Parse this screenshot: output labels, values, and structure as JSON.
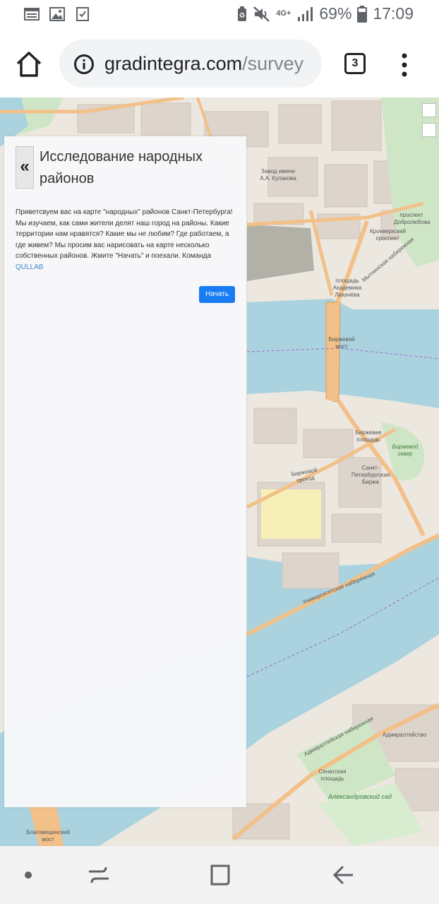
{
  "status_bar": {
    "network_type": "4G+",
    "battery_percent": "69%",
    "time": "17:09",
    "icons": [
      "calendar-icon",
      "gallery-icon",
      "checklist-icon",
      "battery-saver-icon",
      "mute-icon",
      "signal-icon",
      "battery-icon"
    ]
  },
  "browser": {
    "url_domain": "gradintegra.com",
    "url_path": "/survey",
    "tab_count": "3",
    "icons": [
      "home-icon",
      "info-icon",
      "menu-dots-icon"
    ]
  },
  "survey_panel": {
    "collapse_label": "«",
    "title": "Исследование народных районов",
    "intro_text": "Приветсвуем вас на карте \"народных\" районов Санкт-Петербурга! Мы изучаем, как сами жители делят наш город на районы. Какие территории нам нравятся? Какие мы не любим? Где работаем, а где живем? Мы просим вас нарисовать на карте несколько собственных районов. Жмите \"Начать\" и поехали. Команда",
    "team_link": "QULLAB",
    "start_button": "Начать"
  },
  "map": {
    "labels": {
      "birzhevoy_most": "Биржевой мост",
      "birzhevaya_ploshchad": "Биржевая площадь",
      "birzha": "Санкт-Петербургская Биржа",
      "birzhevoy_skver": "Биржевой сквер",
      "likhachev_square": "площадь Академика Лихачёва",
      "kulakov_plant": "Завод имени А.А. Кулакова",
      "kronverkskiy_prospekt": "Кронверкский проспект",
      "prospekt_dobrolyubova": "проспект Добролюбова",
      "universitetskaya_nab": "Университетская набережная",
      "admiralteyskaya_nab": "Адмиралтейская набережная",
      "admiralteystvo": "Адмиралтейство",
      "senatskaya_ploshchad": "Сенатская площадь",
      "aleksandrovskiy_sad": "Александровский сад",
      "blagoveshchenskiy_most": "Благовещенский мост",
      "mytninskaya_nab": "Мытнинская набережная",
      "birzhevoy_proezd": "Биржевой проезд"
    }
  },
  "nav_bar": {
    "icons": [
      "dot-icon",
      "recents-icon",
      "home-square-icon",
      "back-icon"
    ]
  }
}
